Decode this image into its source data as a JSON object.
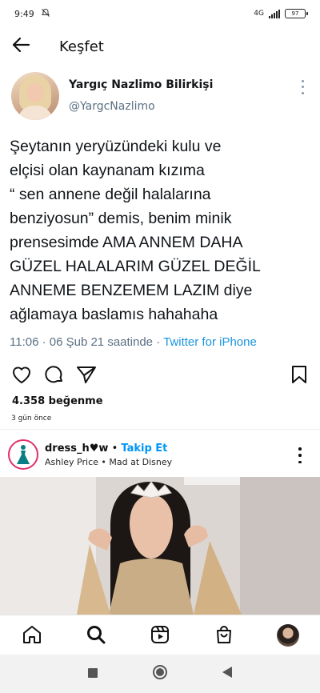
{
  "status_bar": {
    "time": "9:49",
    "network": "4G",
    "battery": "97"
  },
  "header": {
    "title": "Keşfet"
  },
  "tweet": {
    "display_name": "Yargıç Nazlimo Bilirkişi",
    "handle": "@YargcNazlimo",
    "text": "Şeytanın yeryüzündeki kulu ve\nelçisi olan kaynanam kızıma\n“ sen annene değil halalarına\nbenziyosun” demis, benim minik\nprensesimde AMA ANNEM DAHA\nGÜZEL HALALARIM GÜZEL DEĞİL\nANNEME  BENZEMEM LAZIM diye\nağlamaya baslamıs hahahaha",
    "timestamp": "11:06 · 06 Şub 21 saatinde · ",
    "source": "Twitter for iPhone"
  },
  "post": {
    "likes": "4.358 beğenme",
    "time_ago": "3 gün önce"
  },
  "next_post": {
    "username": "dress_h♥w",
    "separator": " • ",
    "follow_label": "Takip Et",
    "subtitle": "Ashley Price • Mad at Disney"
  },
  "icons": {
    "back": "arrow-left-icon",
    "more": "vertical-dots-icon",
    "like": "heart-icon",
    "comment": "comment-icon",
    "share": "send-icon",
    "save": "bookmark-icon",
    "home": "home-icon",
    "search": "search-icon",
    "reels": "reels-icon",
    "shop": "shop-icon",
    "sys_recent": "square-icon",
    "sys_home": "circle-icon",
    "sys_back": "triangle-back-icon"
  },
  "colors": {
    "twitter_blue": "#1b95e0",
    "follow_blue": "#0095f6",
    "handle_grey": "#5b7083"
  }
}
